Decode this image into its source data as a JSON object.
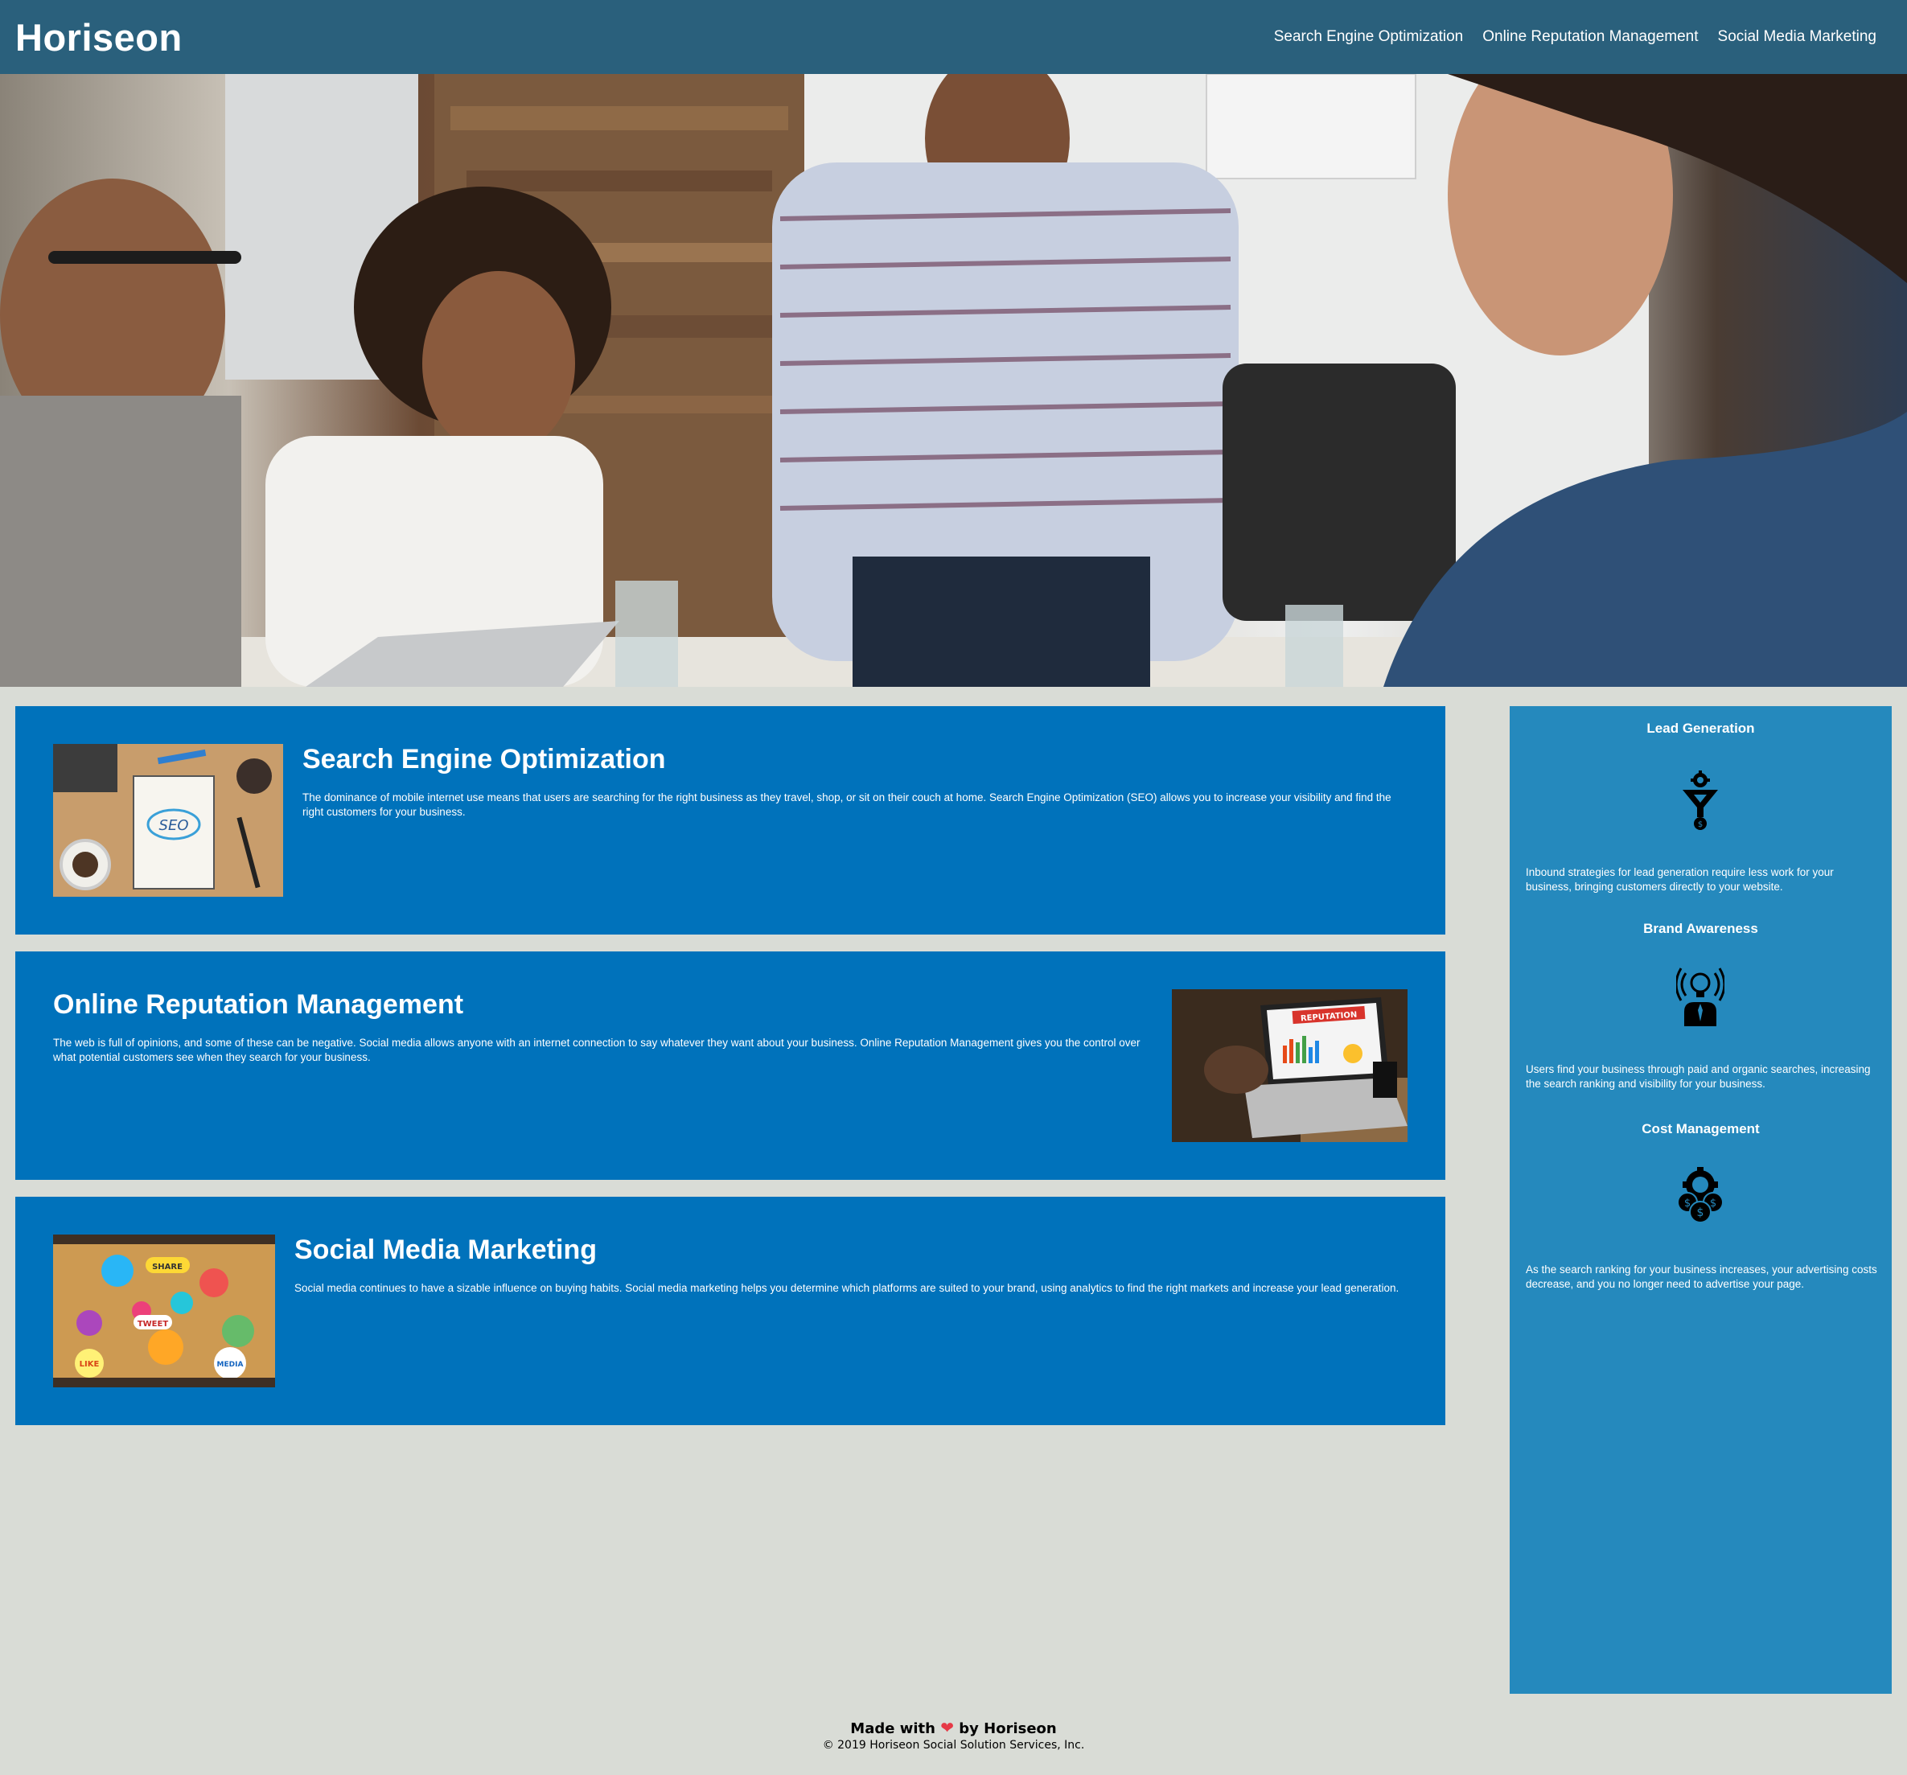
{
  "header": {
    "logo": "Horiseon",
    "nav": [
      {
        "label": "Search Engine Optimization"
      },
      {
        "label": "Online Reputation Management"
      },
      {
        "label": "Social Media Marketing"
      }
    ]
  },
  "sections": [
    {
      "title": "Search Engine Optimization",
      "text": "The dominance of mobile internet use means that users are searching for the right business as they travel, shop, or sit on their couch at home. Search Engine Optimization (SEO) allows you to increase your visibility and find the right customers for your business.",
      "image_label": "SEO"
    },
    {
      "title": "Online Reputation Management",
      "text": "The web is full of opinions, and some of these can be negative. Social media allows anyone with an internet connection to say whatever they want about your business. Online Reputation Management gives you the control over what potential customers see when they search for your business.",
      "image_label": "REPUTATION"
    },
    {
      "title": "Social Media Marketing",
      "text": "Social media continues to have a sizable influence on buying habits. Social media marketing helps you determine which platforms are suited to your brand, using analytics to find the right markets and increase your lead generation.",
      "image_labels": [
        "SHARE",
        "TWEET",
        "LIKE",
        "MEDIA"
      ]
    }
  ],
  "benefits": [
    {
      "title": "Lead Generation",
      "icon": "lead-funnel-icon",
      "text": "Inbound strategies for lead generation require less work for your business, bringing customers directly to your website."
    },
    {
      "title": "Brand Awareness",
      "icon": "brand-lightbulb-icon",
      "text": "Users find your business through paid and organic searches, increasing the search ranking and visibility for your business."
    },
    {
      "title": "Cost Management",
      "icon": "cost-gears-icon",
      "text": "As the search ranking for your business increases, your advertising costs decrease, and you no longer need to advertise your page."
    }
  ],
  "footer": {
    "made_prefix": "Made with",
    "made_suffix": "by Horiseon",
    "copyright": "© 2019 Horiseon Social Solution Services, Inc."
  },
  "colors": {
    "header": "#2a607c",
    "card": "#0072bb",
    "sidebar": "#2589bd",
    "page": "#d9dcd6"
  }
}
